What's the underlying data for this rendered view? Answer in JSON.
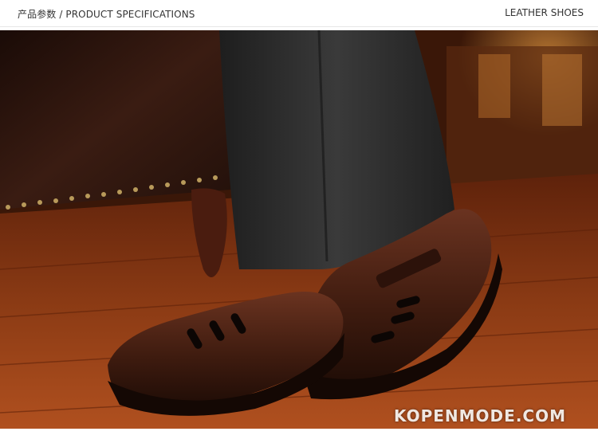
{
  "header": {
    "title": "产品参数 / PRODUCT SPECIFICATIONS",
    "category": "LEATHER SHOES"
  },
  "photo": {
    "subject": "brown leather sandals on wooden floor",
    "watermark": "KOPENMODE.COM"
  },
  "colors": {
    "floor": "#8a3a14",
    "leather": "#3b1a0e",
    "trousers": "#2b2b2b",
    "sofa": "#2a1410"
  }
}
